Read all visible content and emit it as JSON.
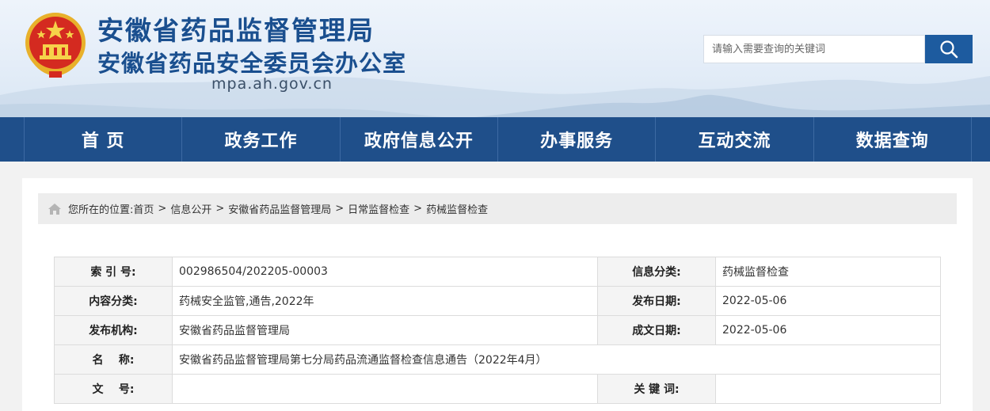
{
  "header": {
    "title_line1": "安徽省药品监督管理局",
    "title_line2": "安徽省药品安全委员会办公室",
    "domain": "mpa.ah.gov.cn",
    "search_placeholder": "请输入需要查询的关键词"
  },
  "nav": {
    "items": [
      {
        "label": "首 页"
      },
      {
        "label": "政务工作"
      },
      {
        "label": "政府信息公开"
      },
      {
        "label": "办事服务"
      },
      {
        "label": "互动交流"
      },
      {
        "label": "数据查询"
      }
    ]
  },
  "breadcrumb": {
    "prefix": "您所在的位置:",
    "items": [
      "首页",
      "信息公开",
      "安徽省药品监督管理局",
      "日常监督检查",
      "药械监督检查"
    ],
    "separator": ">"
  },
  "meta": {
    "index_label": "索 引 号:",
    "index_value": "002986504/202205-00003",
    "category_label": "信息分类:",
    "category_value": "药械监督检查",
    "content_label": "内容分类:",
    "content_value": "药械安全监管,通告,2022年",
    "publish_date_label": "发布日期:",
    "publish_date_value": "2022-05-06",
    "org_label": "发布机构:",
    "org_value": "安徽省药品监督管理局",
    "doc_date_label": "成文日期:",
    "doc_date_value": "2022-05-06",
    "name_label": "名    称:",
    "name_value": "安徽省药品监督管理局第七分局药品流通监督检查信息通告（2022年4月）",
    "docno_label": "文    号:",
    "docno_value": "",
    "keywords_label": "关 键 词:",
    "keywords_value": ""
  },
  "colors": {
    "nav_bg": "#1f4f8a",
    "title": "#1a4f8f",
    "search_btn": "#1d5b9f"
  }
}
